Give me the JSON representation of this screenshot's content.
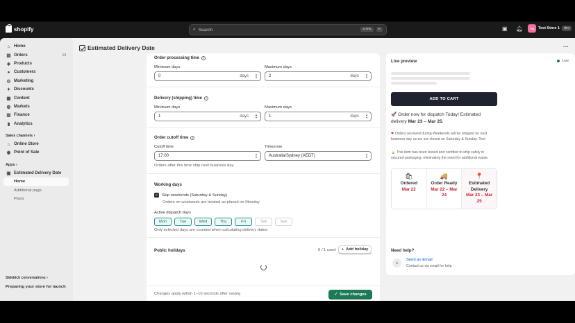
{
  "topbar": {
    "brand": "shopify",
    "search_placeholder": "Search",
    "shortcut_ctrl": "CTRL",
    "shortcut_key": "K",
    "store_initials": "TS",
    "store_name": "Test Store 1",
    "store_tag": "dev"
  },
  "sidebar": {
    "items": [
      {
        "label": "Home",
        "icon": "home-icon"
      },
      {
        "label": "Orders",
        "icon": "orders-icon",
        "count": "14"
      },
      {
        "label": "Products",
        "icon": "tag-icon"
      },
      {
        "label": "Customers",
        "icon": "person-icon"
      },
      {
        "label": "Marketing",
        "icon": "target-icon"
      },
      {
        "label": "Discounts",
        "icon": "discount-icon"
      },
      {
        "label": "Content",
        "icon": "content-icon"
      },
      {
        "label": "Markets",
        "icon": "globe-icon"
      },
      {
        "label": "Finance",
        "icon": "bank-icon"
      },
      {
        "label": "Analytics",
        "icon": "chart-icon"
      }
    ],
    "sales_channels_label": "Sales channels",
    "channels": [
      "Online Store",
      "Point of Sale"
    ],
    "apps_label": "Apps",
    "app_name": "Estimated Delivery Date",
    "app_pages": [
      "Home",
      "Additional page",
      "Plans"
    ],
    "sidekick_label": "Sidekick conversations",
    "launch_label": "Preparing your store for launch"
  },
  "page": {
    "title": "Estimated Delivery Date",
    "more": "···"
  },
  "settings": {
    "processing_title": "Order processing time",
    "delivery_title": "Delivery (shipping) time",
    "min_label": "Minimum days",
    "max_label": "Maximum days",
    "days_suffix": "days",
    "processing_min": "0",
    "processing_max": "2",
    "delivery_min": "1",
    "delivery_max": "1",
    "cutoff_title": "Order cutoff time",
    "cutoff_label": "Cutoff time",
    "cutoff_value": "17:00",
    "timezone_label": "Timezone",
    "timezone_value": "Australia/Sydney (AEDT)",
    "cutoff_help": "Orders after this time ship next business day",
    "working_title": "Working days",
    "skip_weekends_label": "Skip weekends (Saturday & Sunday)",
    "skip_weekends_help": "Orders on weekends are treated as placed on Monday",
    "dispatch_label": "Active dispatch days",
    "dispatch_days": [
      {
        "label": "Mon",
        "active": true
      },
      {
        "label": "Tue",
        "active": true
      },
      {
        "label": "Wed",
        "active": true
      },
      {
        "label": "Thu",
        "active": true
      },
      {
        "label": "Fri",
        "active": true
      },
      {
        "label": "Sat",
        "active": false
      },
      {
        "label": "Sun",
        "active": false
      }
    ],
    "dispatch_help": "Only selected days are counted when calculating delivery dates",
    "holidays_title": "Public holidays",
    "holidays_count": "0 / 1 used",
    "add_holiday": "Add holiday",
    "footer_note": "Changes apply within 1–10 seconds after saving",
    "save_label": "Save changes",
    "save_color": "#1c7a55"
  },
  "preview": {
    "title": "Live preview",
    "live_label": "Live",
    "cart_label": "ADD TO CART",
    "main_prefix": "Order now for dispatch Today! Estimated delivery ",
    "main_dates": "Mar 23 – Mar 25",
    "main_suffix": ".",
    "note1": "Orders received during Weekends will be shipped on next business day as we are closed on Saturday & Sunday. Test",
    "note2": "This item has been tested and certified to ship safely in secured packaging, eliminating the need for additional waste.",
    "timeline": [
      {
        "label": "Ordered",
        "date": "Mar 22",
        "icon": "shopping-bag-icon",
        "glyph": "🛍"
      },
      {
        "label": "Order Ready",
        "date": "Mar 22 – Mar 24",
        "icon": "truck-icon",
        "glyph": "🚚"
      },
      {
        "label": "Estimated Delivery",
        "date": "Mar 23 – Mar 25",
        "icon": "location-pin-icon",
        "glyph": "📍"
      }
    ],
    "date_color": "#c5232e"
  },
  "help_card": {
    "title": "Need help?",
    "link": "Send an Email",
    "sub": "Contact us via email for help"
  }
}
